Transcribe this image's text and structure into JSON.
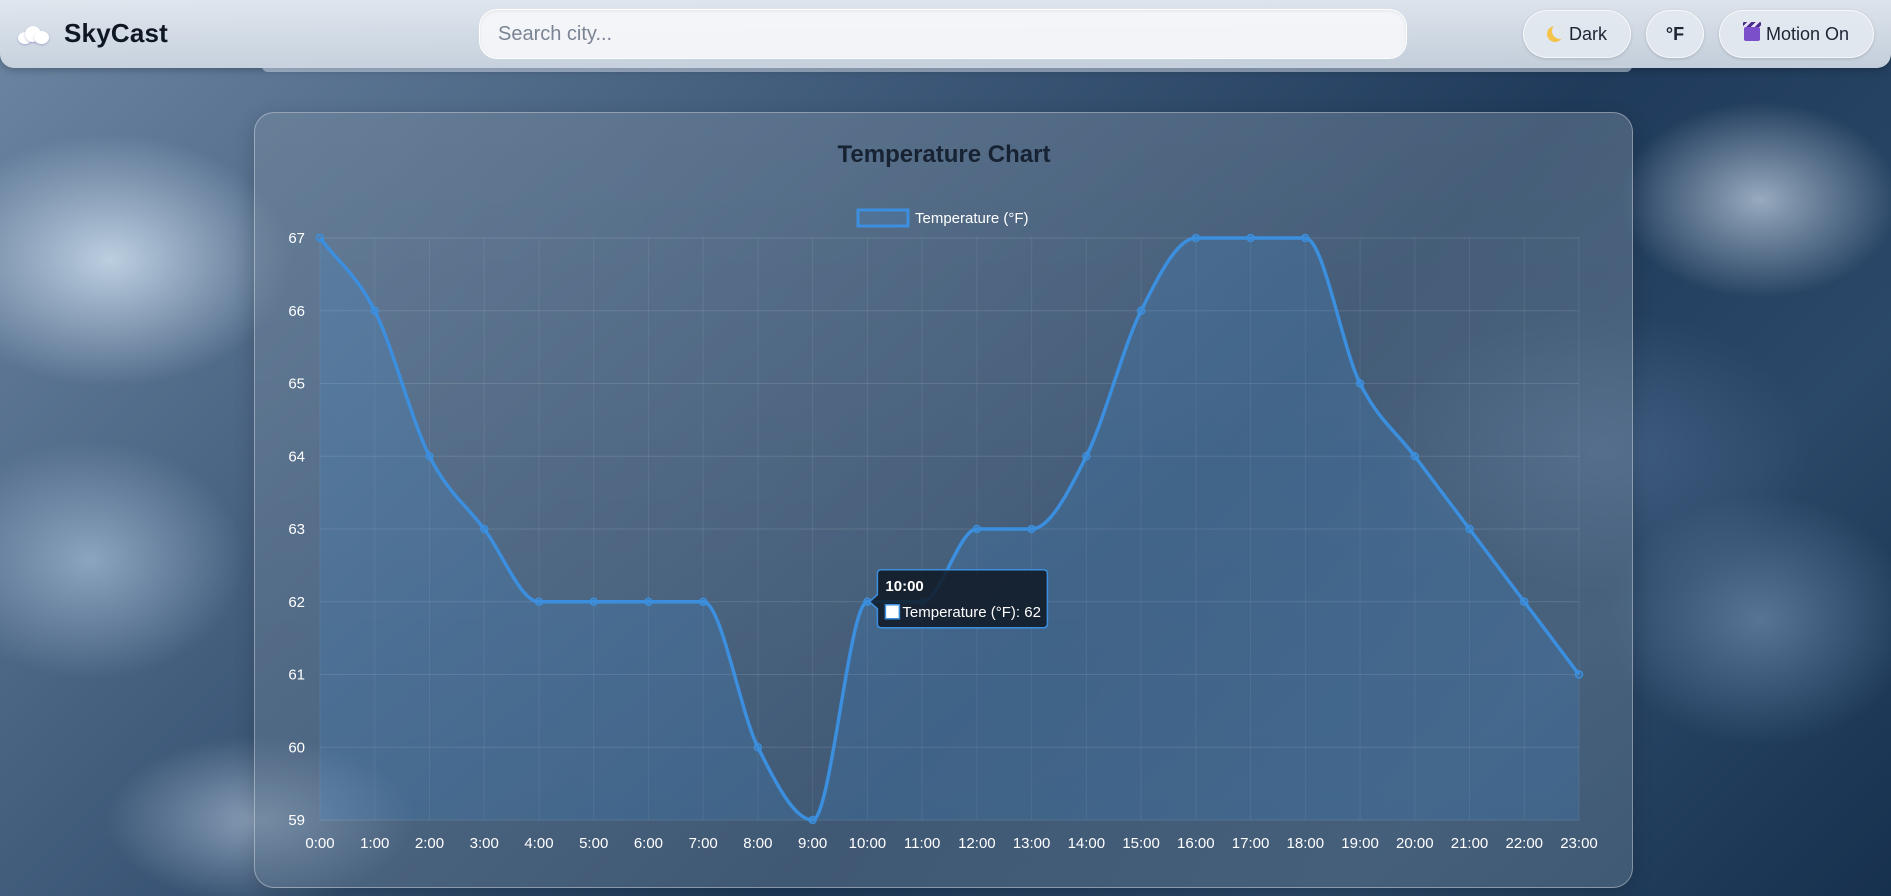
{
  "header": {
    "brand": "SkyCast",
    "brand_icon": "cloud-icon",
    "search_placeholder": "Search city...",
    "buttons": {
      "dark": {
        "label": "Dark",
        "icon": "moon-icon"
      },
      "unit": {
        "label": "°F"
      },
      "motion": {
        "label": "Motion On",
        "icon": "clapper-icon"
      }
    }
  },
  "colors": {
    "line": "#3b8fde",
    "fill": "rgba(59,143,222,0.18)",
    "title": "#172233"
  },
  "tooltip": {
    "title": "10:00",
    "body": "Temperature (°F): 62",
    "index": 10
  },
  "chart_data": {
    "type": "line",
    "title": "Temperature Chart",
    "xlabel": "",
    "ylabel": "",
    "ylim": [
      59,
      67
    ],
    "yticks": [
      67,
      66,
      65,
      64,
      63,
      62,
      61,
      60,
      59
    ],
    "grid": true,
    "legend_position": "top-center",
    "categories": [
      "0:00",
      "1:00",
      "2:00",
      "3:00",
      "4:00",
      "5:00",
      "6:00",
      "7:00",
      "8:00",
      "9:00",
      "10:00",
      "11:00",
      "12:00",
      "13:00",
      "14:00",
      "15:00",
      "16:00",
      "17:00",
      "18:00",
      "19:00",
      "20:00",
      "21:00",
      "22:00",
      "23:00"
    ],
    "series": [
      {
        "name": "Temperature (°F)",
        "values": [
          67,
          66,
          64,
          63,
          62,
          62,
          62,
          62,
          60,
          59,
          62,
          62,
          63,
          63,
          64,
          66,
          67,
          67,
          67,
          65,
          64,
          63,
          62,
          61
        ]
      }
    ]
  }
}
